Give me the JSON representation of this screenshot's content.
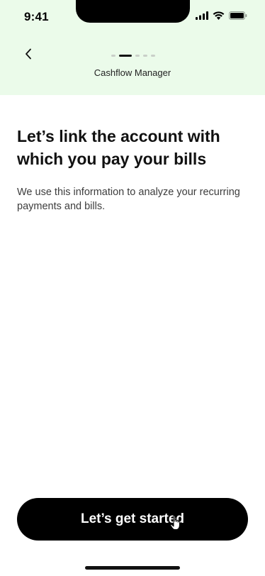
{
  "status_bar": {
    "time": "9:41",
    "icons": [
      "cellular-signal-icon",
      "wifi-icon",
      "battery-icon"
    ]
  },
  "header": {
    "title": "Cashflow Manager",
    "back_icon": "chevron-left-icon",
    "progress": {
      "total_steps": 5,
      "current_step": 2
    }
  },
  "content": {
    "heading": "Let’s link the account with which you pay your bills",
    "description": "We use this information to analyze your recurring payments and bills."
  },
  "cta": {
    "label": "Let’s get started"
  },
  "colors": {
    "header_background": "#ebfbea",
    "button_background": "#000000",
    "button_text": "#ffffff",
    "text_primary": "#111111",
    "text_secondary": "#3d3d3d"
  }
}
